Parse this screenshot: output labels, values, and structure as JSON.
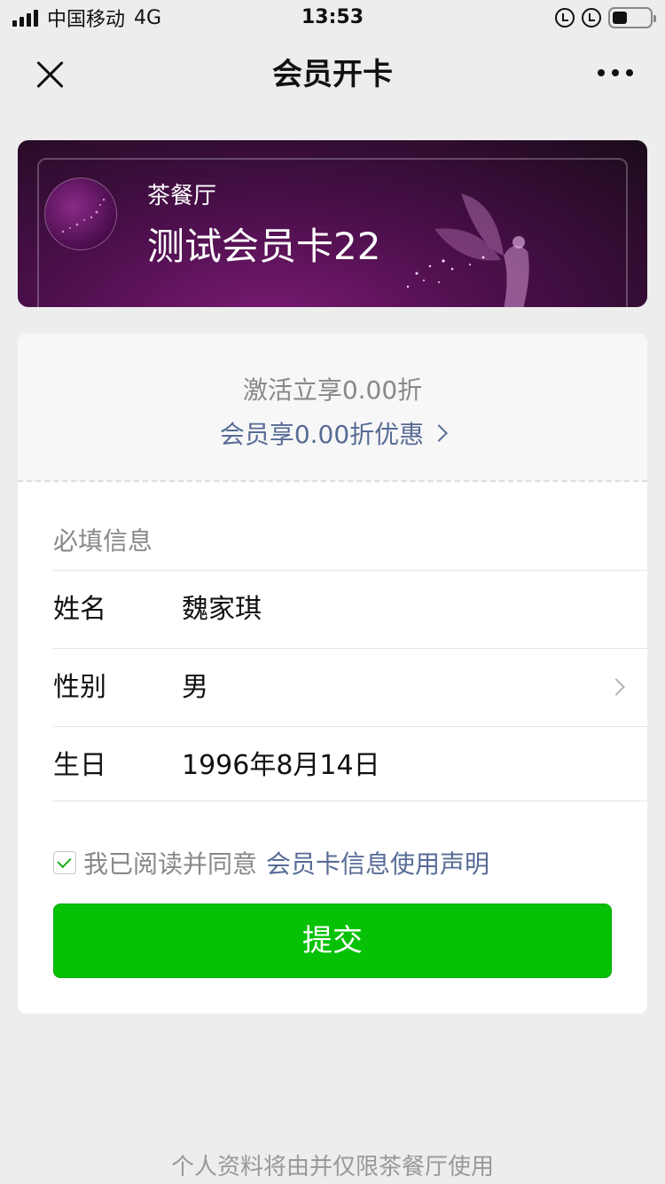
{
  "status_bar": {
    "carrier": "中国移动",
    "network": "4G",
    "time": "13:53"
  },
  "nav": {
    "title": "会员开卡",
    "close_icon": "close-icon",
    "more_icon": "more-icon"
  },
  "card": {
    "shop_name": "茶餐厅",
    "card_name": "测试会员卡22",
    "theme_color": "#5a145a"
  },
  "promo": {
    "activate_text": "激活立享0.00折",
    "discount_link": "会员享0.00折优惠"
  },
  "form": {
    "section_title": "必填信息",
    "fields": [
      {
        "label": "姓名",
        "value": "魏家琪"
      },
      {
        "label": "性别",
        "value": "男"
      },
      {
        "label": "生日",
        "value": "1996年8月14日"
      }
    ]
  },
  "agreement": {
    "checked": true,
    "text": "我已阅读并同意",
    "link": "会员卡信息使用声明"
  },
  "submit_label": "提交",
  "footer_text": "个人资料将由并仅限茶餐厅使用",
  "colors": {
    "accent_green": "#07c107",
    "link_blue": "#576b95"
  }
}
